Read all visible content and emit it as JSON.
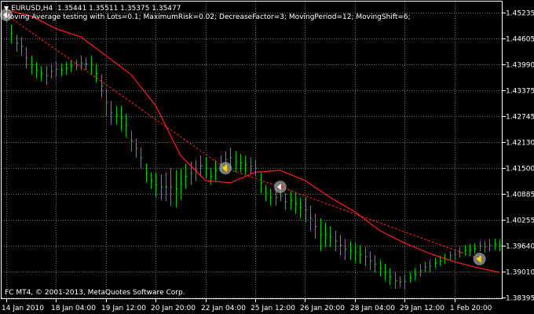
{
  "header": {
    "symbol": "EURUSD,H4",
    "ohlc": "1.35441 1.35511 1.35375 1.35477",
    "comment": "Moving Average testing with Lots=0.1; MaximumRisk=0.02; DecreaseFactor=3; MovingPeriod=12; MovingShift=6;"
  },
  "footer": {
    "copyright": "FC MT4, © 2001-2013, MetaQuotes Software Corp."
  },
  "colors": {
    "background": "#000000",
    "frame": "#ffffff",
    "grid": "#707070",
    "bars": "#00cc00",
    "moving_average": "#ff2020",
    "order_line": "#ff2020",
    "text": "#ffffff",
    "marker_halo": "#a0a0a0",
    "marker_buy": "#ffffff",
    "marker_sell": "#ffd700"
  },
  "chart_data": {
    "type": "line",
    "price_axis": {
      "labels": [
        "1.45235",
        "1.44605",
        "1.43990",
        "1.43375",
        "1.42745",
        "1.42130",
        "1.41500",
        "1.40885",
        "1.40255",
        "1.39640",
        "1.39010",
        "1.38395"
      ],
      "range": [
        1.38395,
        1.45235
      ]
    },
    "time_axis": {
      "labels": [
        "14 Jan 2010",
        "18 Jan 04:00",
        "19 Jan 12:00",
        "20 Jan 20:00",
        "22 Jan 04:00",
        "25 Jan 12:00",
        "26 Jan 20:00",
        "28 Jan 04:00",
        "29 Jan 12:00",
        "1 Feb 20:00"
      ]
    },
    "bar_count": 100,
    "series": [
      {
        "kind": "ohlc_bars",
        "values": [
          [
            1.453,
            1.45
          ],
          [
            1.4495,
            1.445
          ],
          [
            1.447,
            1.443
          ],
          [
            1.4465,
            1.442
          ],
          [
            1.444,
            1.439
          ],
          [
            1.442,
            1.4375
          ],
          [
            1.4405,
            1.4365
          ],
          [
            1.4395,
            1.436
          ],
          [
            1.4395,
            1.435
          ],
          [
            1.44,
            1.4365
          ],
          [
            1.4405,
            1.437
          ],
          [
            1.44,
            1.437
          ],
          [
            1.4405,
            1.4375
          ],
          [
            1.441,
            1.438
          ],
          [
            1.441,
            1.4385
          ],
          [
            1.442,
            1.4385
          ],
          [
            1.4415,
            1.4385
          ],
          [
            1.442,
            1.4375
          ],
          [
            1.44,
            1.4355
          ],
          [
            1.4375,
            1.432
          ],
          [
            1.434,
            1.4275
          ],
          [
            1.431,
            1.4255
          ],
          [
            1.43,
            1.4255
          ],
          [
            1.43,
            1.424
          ],
          [
            1.428,
            1.4225
          ],
          [
            1.424,
            1.419
          ],
          [
            1.422,
            1.4175
          ],
          [
            1.42,
            1.415
          ],
          [
            1.416,
            1.4115
          ],
          [
            1.414,
            1.41
          ],
          [
            1.414,
            1.408
          ],
          [
            1.4135,
            1.4075
          ],
          [
            1.414,
            1.407
          ],
          [
            1.415,
            1.406
          ],
          [
            1.4145,
            1.4055
          ],
          [
            1.415,
            1.4075
          ],
          [
            1.416,
            1.41
          ],
          [
            1.4165,
            1.411
          ],
          [
            1.417,
            1.412
          ],
          [
            1.418,
            1.413
          ],
          [
            1.4175,
            1.4125
          ],
          [
            1.415,
            1.411
          ],
          [
            1.417,
            1.412
          ],
          [
            1.418,
            1.414
          ],
          [
            1.419,
            1.415
          ],
          [
            1.42,
            1.415
          ],
          [
            1.419,
            1.414
          ],
          [
            1.4185,
            1.414
          ],
          [
            1.418,
            1.4135
          ],
          [
            1.4175,
            1.4135
          ],
          [
            1.417,
            1.413
          ],
          [
            1.414,
            1.409
          ],
          [
            1.411,
            1.407
          ],
          [
            1.41,
            1.406
          ],
          [
            1.41,
            1.406
          ],
          [
            1.4095,
            1.407
          ],
          [
            1.409,
            1.405
          ],
          [
            1.4095,
            1.405
          ],
          [
            1.409,
            1.404
          ],
          [
            1.408,
            1.403
          ],
          [
            1.408,
            1.402
          ],
          [
            1.406,
            1.4
          ],
          [
            1.404,
            1.398
          ],
          [
            1.403,
            1.395
          ],
          [
            1.402,
            1.396
          ],
          [
            1.401,
            1.396
          ],
          [
            1.4,
            1.395
          ],
          [
            1.399,
            1.394
          ],
          [
            1.398,
            1.393
          ],
          [
            1.3975,
            1.393
          ],
          [
            1.397,
            1.3925
          ],
          [
            1.3965,
            1.392
          ],
          [
            1.396,
            1.3915
          ],
          [
            1.395,
            1.3905
          ],
          [
            1.394,
            1.39
          ],
          [
            1.393,
            1.389
          ],
          [
            1.392,
            1.388
          ],
          [
            1.391,
            1.387
          ],
          [
            1.39,
            1.386
          ],
          [
            1.389,
            1.3865
          ],
          [
            1.3895,
            1.386
          ],
          [
            1.39,
            1.3875
          ],
          [
            1.391,
            1.388
          ],
          [
            1.392,
            1.389
          ],
          [
            1.3925,
            1.39
          ],
          [
            1.393,
            1.39
          ],
          [
            1.3935,
            1.391
          ],
          [
            1.394,
            1.3915
          ],
          [
            1.3945,
            1.392
          ],
          [
            1.395,
            1.393
          ],
          [
            1.3955,
            1.393
          ],
          [
            1.396,
            1.3935
          ],
          [
            1.3965,
            1.394
          ],
          [
            1.3968,
            1.394
          ],
          [
            1.397,
            1.3945
          ],
          [
            1.3975,
            1.395
          ],
          [
            1.3975,
            1.3948
          ],
          [
            1.398,
            1.395
          ],
          [
            1.398,
            1.3955
          ],
          [
            1.3978,
            1.395
          ]
        ]
      },
      {
        "kind": "moving_average",
        "x": [
          0,
          5,
          10,
          15,
          20,
          25,
          30,
          35,
          40,
          45,
          50,
          55,
          60,
          65,
          70,
          75,
          80,
          85,
          90,
          95,
          99
        ],
        "values": [
          1.453,
          1.4515,
          1.4485,
          1.4465,
          1.442,
          1.4375,
          1.43,
          1.418,
          1.412,
          1.4115,
          1.414,
          1.4145,
          1.412,
          1.408,
          1.4045,
          1.4,
          1.397,
          1.3945,
          1.3925,
          1.391,
          1.39
        ]
      },
      {
        "kind": "order_line",
        "style": "dashed",
        "x": [
          0,
          44,
          55,
          95
        ],
        "values": [
          1.4518,
          1.415,
          1.4105,
          1.3932
        ]
      }
    ],
    "markers": [
      {
        "kind": "buy",
        "x": 0,
        "value": 1.4518
      },
      {
        "kind": "sell",
        "x": 44,
        "value": 1.415
      },
      {
        "kind": "buy",
        "x": 55,
        "value": 1.4105
      },
      {
        "kind": "sell",
        "x": 95,
        "value": 1.3932
      }
    ],
    "grid": true,
    "legend": "none"
  }
}
